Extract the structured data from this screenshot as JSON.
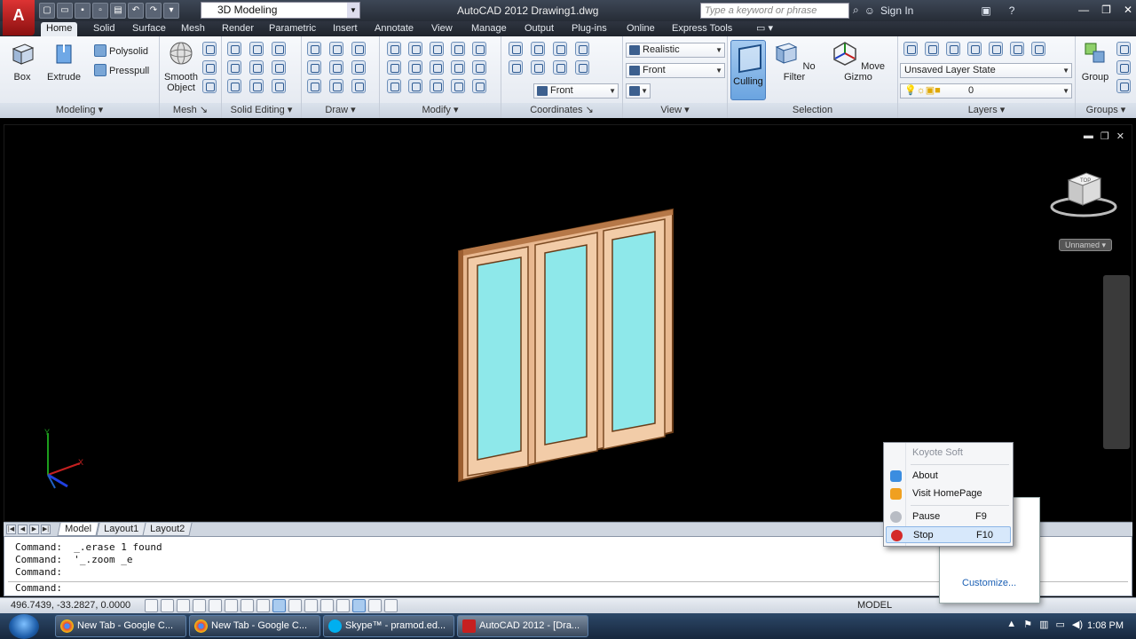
{
  "window": {
    "title": "AutoCAD 2012    Drawing1.dwg",
    "workspace": "3D Modeling",
    "search_placeholder": "Type a keyword or phrase",
    "sign_in": "Sign In"
  },
  "ribbon_tabs": [
    "Home",
    "Solid",
    "Surface",
    "Mesh",
    "Render",
    "Parametric",
    "Insert",
    "Annotate",
    "View",
    "Manage",
    "Output",
    "Plug-ins",
    "Online",
    "Express Tools"
  ],
  "ribbon": {
    "modeling": {
      "title": "Modeling",
      "box": "Box",
      "extrude": "Extrude",
      "polysolid": "Polysolid",
      "presspull": "Presspull"
    },
    "mesh": {
      "title": "Mesh",
      "smooth_object_1": "Smooth",
      "smooth_object_2": "Object"
    },
    "solid_editing": {
      "title": "Solid Editing"
    },
    "draw": {
      "title": "Draw"
    },
    "modify": {
      "title": "Modify"
    },
    "coordinates": {
      "title": "Coordinates",
      "ucs_combo": "Front"
    },
    "view": {
      "title": "View",
      "visual_style": "Realistic",
      "view_combo": "Front"
    },
    "selection": {
      "title": "Selection",
      "culling": "Culling",
      "no_filter": "No Filter",
      "move_gizmo": "Move Gizmo"
    },
    "layers": {
      "title": "Layers",
      "layer_state": "Unsaved Layer State",
      "current_layer": "0"
    },
    "groups": {
      "title": "Groups",
      "group": "Group"
    }
  },
  "viewport": {
    "unnamed_label": "Unnamed",
    "viewcube_label": "TOP"
  },
  "layout_tabs": [
    "Model",
    "Layout1",
    "Layout2"
  ],
  "command_line": {
    "history": [
      "Command:  _.erase 1 found",
      "Command:  '_.zoom _e",
      "Command:"
    ],
    "prompt": "Command:"
  },
  "status": {
    "coords": "496.7439, -33.2827, 0.0000",
    "model": "MODEL"
  },
  "context_menu": {
    "header": "Koyote Soft",
    "items": [
      {
        "label": "About",
        "shortcut": ""
      },
      {
        "label": "Visit HomePage",
        "shortcut": ""
      },
      {
        "label": "Pause",
        "shortcut": "F9"
      },
      {
        "label": "Stop",
        "shortcut": "F10"
      }
    ],
    "customize": "Customize..."
  },
  "taskbar": {
    "items": [
      "New Tab - Google C...",
      "New Tab - Google C...",
      "Skype™ - pramod.ed...",
      "AutoCAD 2012 - [Dra..."
    ],
    "clock": "1:08 PM"
  }
}
